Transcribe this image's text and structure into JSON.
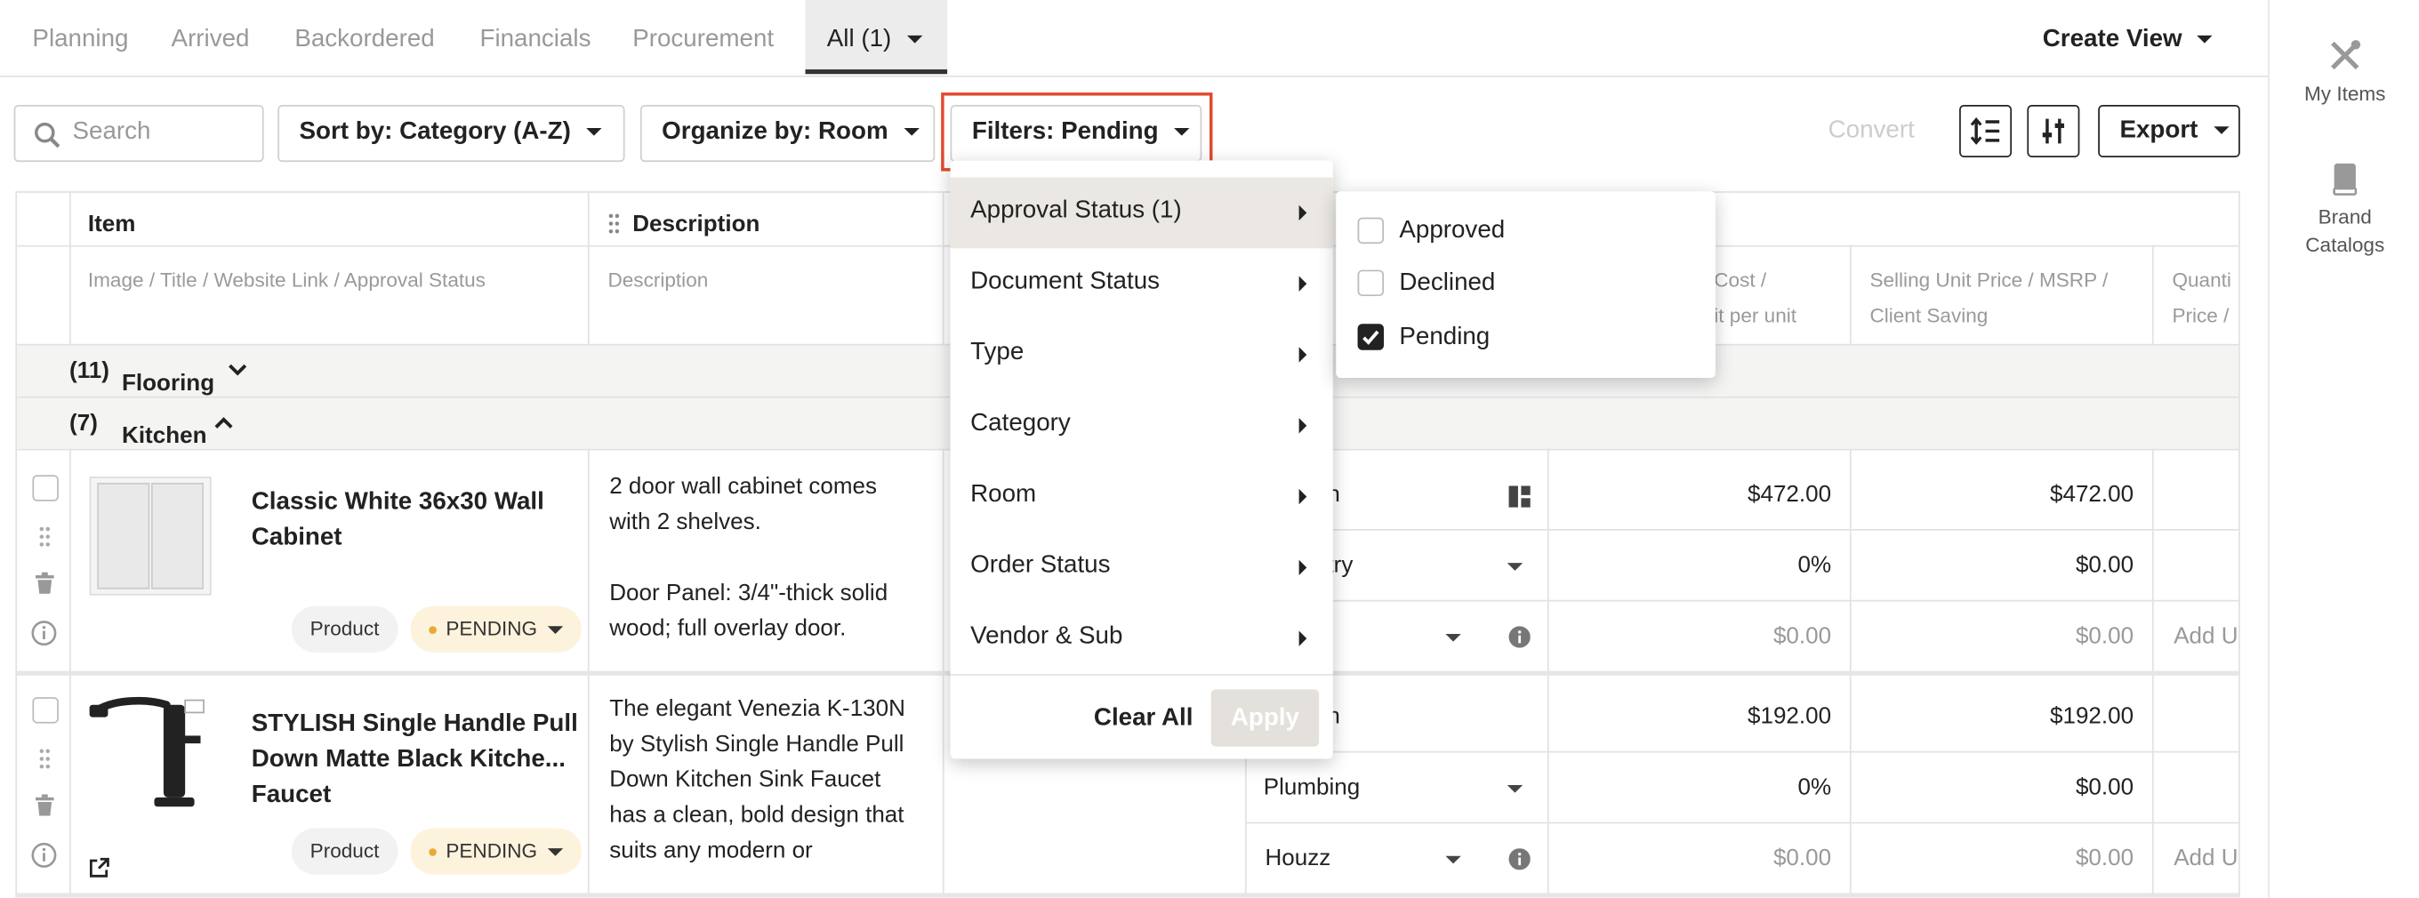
{
  "tabs": [
    {
      "label": "Planning",
      "active": false
    },
    {
      "label": "Arrived",
      "active": false
    },
    {
      "label": "Backordered",
      "active": false
    },
    {
      "label": "Financials",
      "active": false
    },
    {
      "label": "Procurement",
      "active": false
    },
    {
      "label": "All (1)",
      "active": true
    }
  ],
  "create_view": "Create View",
  "toolbar": {
    "search_placeholder": "Search",
    "sort": "Sort by: Category (A-Z)",
    "organize": "Organize by: Room",
    "filters": "Filters: Pending",
    "convert": "Convert",
    "export": "Export"
  },
  "sidebar": {
    "my_items": "My Items",
    "brand_catalogs": "Brand Catalogs"
  },
  "table": {
    "headers": {
      "item": "Item",
      "description": "Description"
    },
    "subheaders": {
      "item": "Image / Title / Website Link / Approval Status",
      "description": "Description",
      "cost_line1": "Cost /",
      "cost_line2": "it per unit",
      "selling_line1": "Selling Unit Price / MSRP /",
      "selling_line2": "Client Saving",
      "qty_line1": "Quanti",
      "qty_line2": "Price /"
    },
    "groups": [
      {
        "label": "Flooring",
        "count": "(11)"
      },
      {
        "label": "Kitchen",
        "count": "(7)"
      }
    ],
    "rows": [
      {
        "title_line1": "Classic White 36x30 Wall",
        "title_line2": "Cabinet",
        "type_chip": "Product",
        "status_chip": "PENDING",
        "desc_lines": [
          "2 door wall cabinet comes",
          "with 2 shelves.",
          "",
          "Door Panel: 3/4\"-thick solid",
          "wood; full overlay door."
        ],
        "col_a": [
          "en",
          "etry",
          "t"
        ],
        "cost": [
          "$472.00",
          "0%",
          "$0.00"
        ],
        "selling": [
          "$472.00",
          "$0.00",
          "$0.00"
        ],
        "qty": "Add U"
      },
      {
        "title_line1": "STYLISH Single Handle Pull",
        "title_line2": "Down Matte Black Kitche...",
        "title_line3": "Faucet",
        "type_chip": "Product",
        "status_chip": "PENDING",
        "desc_lines": [
          "The elegant Venezia K-130N",
          "by Stylish Single Handle Pull",
          "Down Kitchen Sink Faucet",
          "has a clean, bold design that",
          "suits any modern or"
        ],
        "col_a": [
          "en",
          "Plumbing",
          "Houzz"
        ],
        "cost": [
          "$192.00",
          "0%",
          "$0.00"
        ],
        "selling": [
          "$192.00",
          "$0.00",
          "$0.00"
        ],
        "qty": "Add U"
      }
    ]
  },
  "filter_menu": {
    "items": [
      "Approval Status (1)",
      "Document Status",
      "Type",
      "Category",
      "Room",
      "Order Status",
      "Vendor & Sub"
    ],
    "clear_all": "Clear All",
    "apply": "Apply"
  },
  "approval_submenu": [
    {
      "label": "Approved",
      "checked": false
    },
    {
      "label": "Declined",
      "checked": false
    },
    {
      "label": "Pending",
      "checked": true
    }
  ],
  "colors": {
    "highlight": "#e04a2f",
    "pending_bg": "#fdf3dc",
    "pending_dot": "#e8a93a",
    "selected_menu": "#ebe8e4"
  }
}
